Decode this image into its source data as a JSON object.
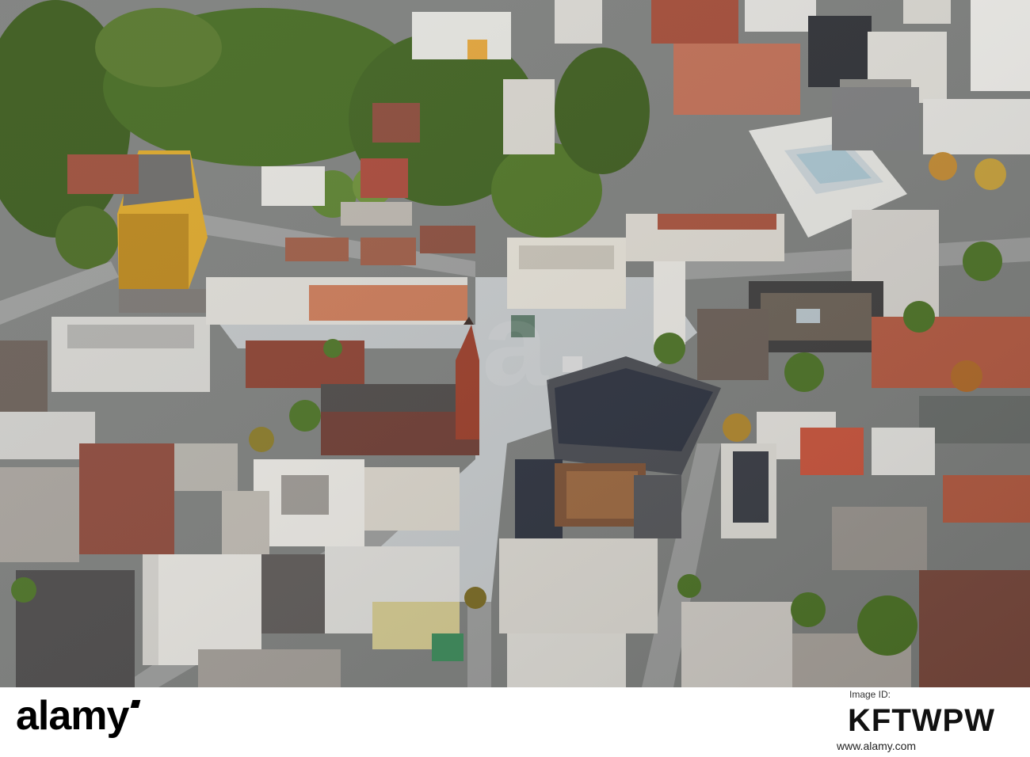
{
  "photo": {
    "description_icon": "aerial-city-photo",
    "palette": {
      "street": "#8d8f8f",
      "plaza": "#c9cdcf",
      "tree": "#3d5a1f",
      "roof_light": "#d7d6d1",
      "roof_dark": "#4a4a4c",
      "roof_red": "#9b4a36",
      "tower_yellow": "#d8a52a"
    }
  },
  "footer": {
    "logo_text": "alamy",
    "image_id_label": "Image ID:",
    "image_id": "KFTWPW",
    "url": "www.alamy.com"
  },
  "watermark": {
    "text": "a"
  }
}
